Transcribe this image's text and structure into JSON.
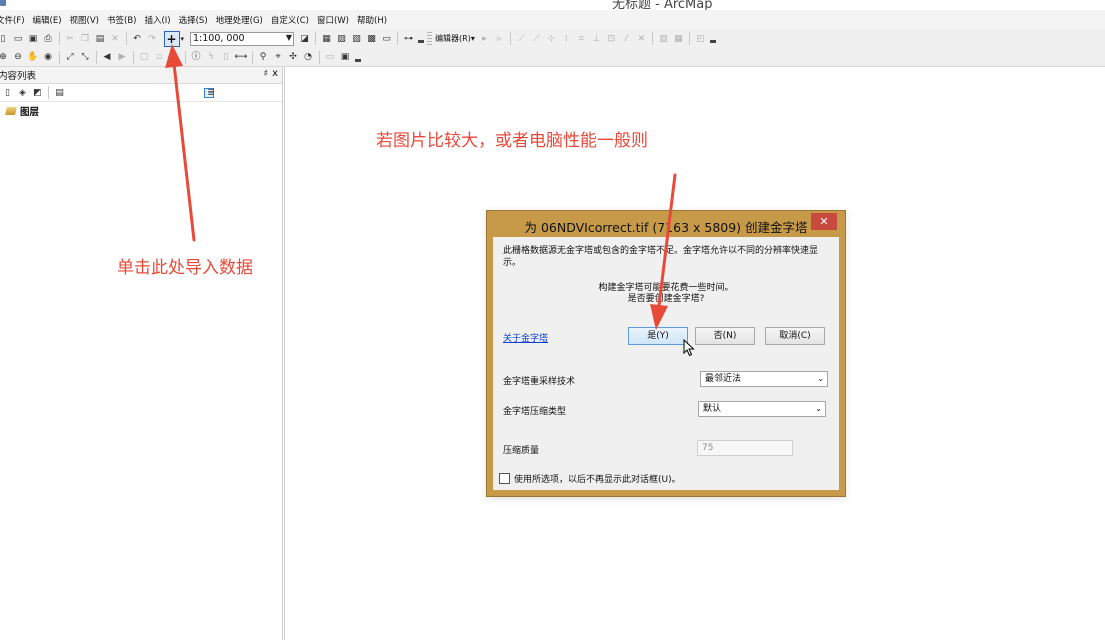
{
  "window": {
    "title": "无标题 - ArcMap"
  },
  "menu": [
    "文件(F)",
    "编辑(E)",
    "视图(V)",
    "书签(B)",
    "插入(I)",
    "选择(S)",
    "地理处理(G)",
    "自定义(C)",
    "窗口(W)",
    "帮助(H)"
  ],
  "toolbar": {
    "scale_value": "1:100, 000",
    "editor_label": "编辑器(R)▾"
  },
  "toc": {
    "title": "内容列表",
    "pin": "♯",
    "close": "x",
    "layers_label": "图层"
  },
  "dialog": {
    "title": "为 06NDVIcorrect.tif (7163 x 5809) 创建金字塔",
    "close": "✕",
    "message": "此栅格数据源无金字塔或包含的金字塔不足。金字塔允许以不同的分辨率快速显示。",
    "prompt_line1": "构建金字塔可能要花费一些时间。",
    "prompt_line2": "是否要创建金字塔?",
    "about_link": "关于金字塔",
    "yes_button": "是(Y)",
    "no_button": "否(N)",
    "cancel_button": "取消(C)",
    "resample_label": "金字塔重采样技术",
    "resample_value": "最邻近法",
    "compression_label": "金字塔压缩类型",
    "compression_value": "默认",
    "quality_label": "压缩质量",
    "quality_value": "75",
    "checkbox_label": "使用所选项，以后不再显示此对话框(U)。"
  },
  "annotations": {
    "left": "单击此处导入数据",
    "right": "若图片比较大，或者电脑性能一般则"
  },
  "colors": {
    "annotation": "#e84a3a",
    "dialog_frame": "#c79a4a",
    "close_button": "#c84a3e",
    "link": "#0b3fd1"
  }
}
